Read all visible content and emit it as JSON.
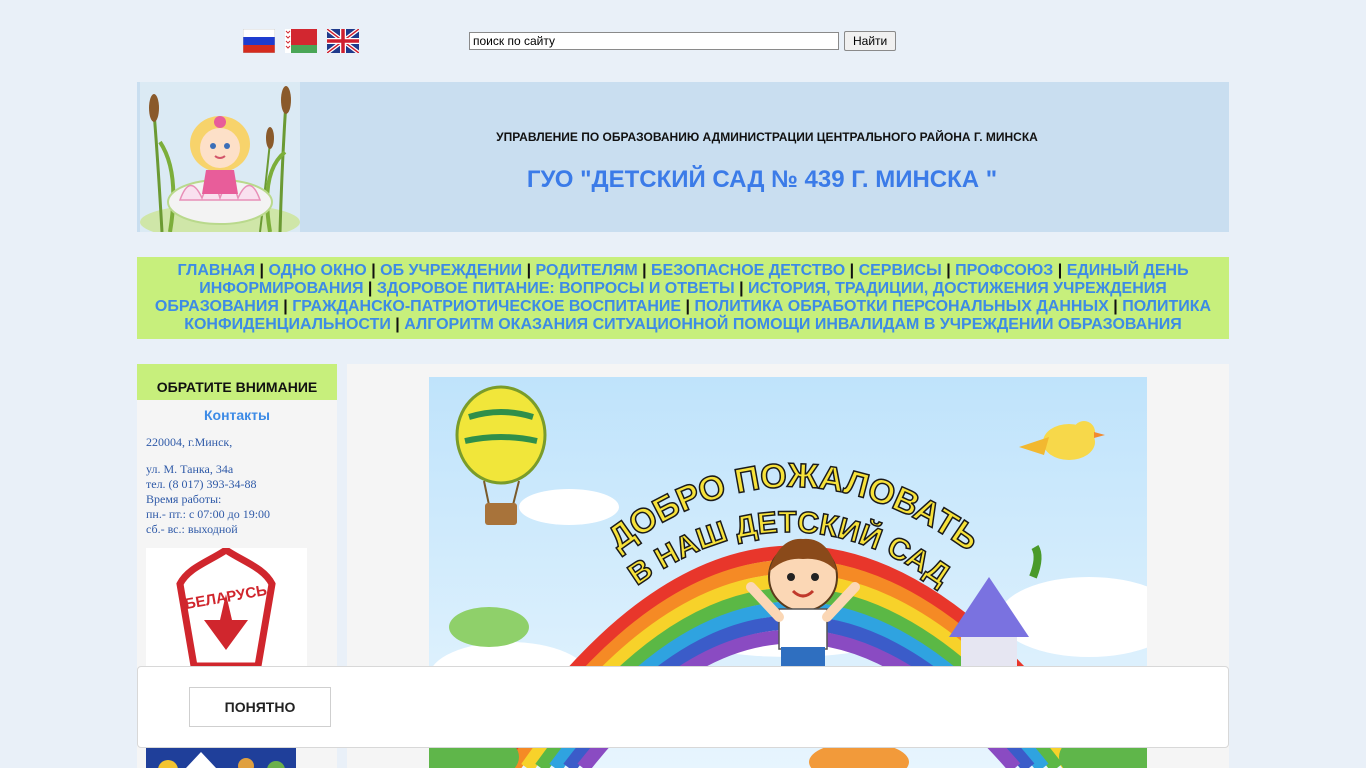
{
  "languages": [
    {
      "name": "russian-flag-icon"
    },
    {
      "name": "belarus-flag-icon"
    },
    {
      "name": "uk-flag-icon"
    }
  ],
  "search": {
    "value": "поиск по сайту",
    "button_label": "Найти"
  },
  "header": {
    "org_line": "УПРАВЛЕНИЕ ПО ОБРАЗОВАНИЮ АДМИНИСТРАЦИИ ЦЕНТРАЛЬНОГО РАЙОНА Г. МИНСКА",
    "title": "ГУО \"ДЕТСКИЙ САД № 439 Г. МИНСКА \""
  },
  "nav": [
    "ГЛАВНАЯ",
    "ОДНО ОКНО",
    "ОБ УЧРЕЖДЕНИИ",
    "РОДИТЕЛЯМ",
    "БЕЗОПАСНОЕ ДЕТСТВО",
    "СЕРВИСЫ",
    "ПРОФСОЮЗ",
    "ЕДИНЫЙ ДЕНЬ ИНФОРМИРОВАНИЯ",
    "ЗДОРОВОЕ ПИТАНИЕ: ВОПРОСЫ И ОТВЕТЫ",
    "ИСТОРИЯ, ТРАДИЦИИ, ДОСТИЖЕНИЯ УЧРЕЖДЕНИЯ ОБРАЗОВАНИЯ",
    "ГРАЖДАНСКО-ПАТРИОТИЧЕСКОЕ ВОСПИТАНИЕ",
    "ПОЛИТИКА ОБРАБОТКИ ПЕРСОНАЛЬНЫХ ДАННЫХ",
    "ПОЛИТИКА КОНФИДЕНЦИАЛЬНОСТИ",
    "АЛГОРИТМ ОКАЗАНИЯ СИТУАЦИОННОЙ ПОМОЩИ ИНВАЛИДАМ В УЧРЕЖДЕНИИ ОБРАЗОВАНИЯ"
  ],
  "nav_separator": "|",
  "sidebar": {
    "heading": "ОБРАТИТЕ ВНИМАНИЕ",
    "subheading": "Контакты",
    "address_line1": "220004, г.Минск,",
    "address_line2": "ул. М. Танка, 34а",
    "phone": "тел. (8 017) 393-34-88",
    "hours_label": "Время работы:",
    "hours_weekdays": "пн.- пт.: с 07:00 до 19:00",
    "hours_weekend": "сб.- вс.: выходной",
    "emblem_text": "БЕЛАРУСЬ"
  },
  "hero": {
    "banner_line1": "ДОБРО ПОЖАЛОВАТЬ",
    "banner_line2": "В НАШ ДЕТСКИЙ САД"
  },
  "cookie": {
    "button_label": "ПОНЯТНО"
  },
  "colors": {
    "page_bg": "#e9f0f8",
    "header_bg": "#c9def0",
    "accent_green": "#c7ef7c",
    "link_blue": "#3d8be6",
    "title_blue": "#3b7be8"
  }
}
